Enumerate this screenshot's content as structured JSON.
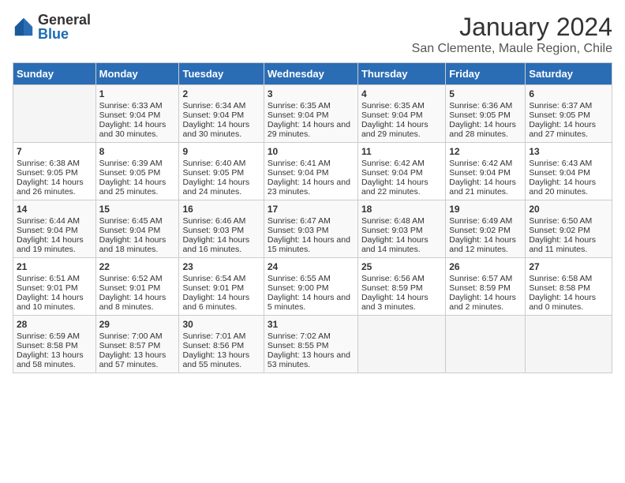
{
  "header": {
    "logo_general": "General",
    "logo_blue": "Blue",
    "title": "January 2024",
    "subtitle": "San Clemente, Maule Region, Chile"
  },
  "calendar": {
    "days_of_week": [
      "Sunday",
      "Monday",
      "Tuesday",
      "Wednesday",
      "Thursday",
      "Friday",
      "Saturday"
    ],
    "weeks": [
      [
        {
          "day": "",
          "content": ""
        },
        {
          "day": "1",
          "content": "Sunrise: 6:33 AM\nSunset: 9:04 PM\nDaylight: 14 hours and 30 minutes."
        },
        {
          "day": "2",
          "content": "Sunrise: 6:34 AM\nSunset: 9:04 PM\nDaylight: 14 hours and 30 minutes."
        },
        {
          "day": "3",
          "content": "Sunrise: 6:35 AM\nSunset: 9:04 PM\nDaylight: 14 hours and 29 minutes."
        },
        {
          "day": "4",
          "content": "Sunrise: 6:35 AM\nSunset: 9:04 PM\nDaylight: 14 hours and 29 minutes."
        },
        {
          "day": "5",
          "content": "Sunrise: 6:36 AM\nSunset: 9:05 PM\nDaylight: 14 hours and 28 minutes."
        },
        {
          "day": "6",
          "content": "Sunrise: 6:37 AM\nSunset: 9:05 PM\nDaylight: 14 hours and 27 minutes."
        }
      ],
      [
        {
          "day": "7",
          "content": "Sunrise: 6:38 AM\nSunset: 9:05 PM\nDaylight: 14 hours and 26 minutes."
        },
        {
          "day": "8",
          "content": "Sunrise: 6:39 AM\nSunset: 9:05 PM\nDaylight: 14 hours and 25 minutes."
        },
        {
          "day": "9",
          "content": "Sunrise: 6:40 AM\nSunset: 9:05 PM\nDaylight: 14 hours and 24 minutes."
        },
        {
          "day": "10",
          "content": "Sunrise: 6:41 AM\nSunset: 9:04 PM\nDaylight: 14 hours and 23 minutes."
        },
        {
          "day": "11",
          "content": "Sunrise: 6:42 AM\nSunset: 9:04 PM\nDaylight: 14 hours and 22 minutes."
        },
        {
          "day": "12",
          "content": "Sunrise: 6:42 AM\nSunset: 9:04 PM\nDaylight: 14 hours and 21 minutes."
        },
        {
          "day": "13",
          "content": "Sunrise: 6:43 AM\nSunset: 9:04 PM\nDaylight: 14 hours and 20 minutes."
        }
      ],
      [
        {
          "day": "14",
          "content": "Sunrise: 6:44 AM\nSunset: 9:04 PM\nDaylight: 14 hours and 19 minutes."
        },
        {
          "day": "15",
          "content": "Sunrise: 6:45 AM\nSunset: 9:04 PM\nDaylight: 14 hours and 18 minutes."
        },
        {
          "day": "16",
          "content": "Sunrise: 6:46 AM\nSunset: 9:03 PM\nDaylight: 14 hours and 16 minutes."
        },
        {
          "day": "17",
          "content": "Sunrise: 6:47 AM\nSunset: 9:03 PM\nDaylight: 14 hours and 15 minutes."
        },
        {
          "day": "18",
          "content": "Sunrise: 6:48 AM\nSunset: 9:03 PM\nDaylight: 14 hours and 14 minutes."
        },
        {
          "day": "19",
          "content": "Sunrise: 6:49 AM\nSunset: 9:02 PM\nDaylight: 14 hours and 12 minutes."
        },
        {
          "day": "20",
          "content": "Sunrise: 6:50 AM\nSunset: 9:02 PM\nDaylight: 14 hours and 11 minutes."
        }
      ],
      [
        {
          "day": "21",
          "content": "Sunrise: 6:51 AM\nSunset: 9:01 PM\nDaylight: 14 hours and 10 minutes."
        },
        {
          "day": "22",
          "content": "Sunrise: 6:52 AM\nSunset: 9:01 PM\nDaylight: 14 hours and 8 minutes."
        },
        {
          "day": "23",
          "content": "Sunrise: 6:54 AM\nSunset: 9:01 PM\nDaylight: 14 hours and 6 minutes."
        },
        {
          "day": "24",
          "content": "Sunrise: 6:55 AM\nSunset: 9:00 PM\nDaylight: 14 hours and 5 minutes."
        },
        {
          "day": "25",
          "content": "Sunrise: 6:56 AM\nSunset: 8:59 PM\nDaylight: 14 hours and 3 minutes."
        },
        {
          "day": "26",
          "content": "Sunrise: 6:57 AM\nSunset: 8:59 PM\nDaylight: 14 hours and 2 minutes."
        },
        {
          "day": "27",
          "content": "Sunrise: 6:58 AM\nSunset: 8:58 PM\nDaylight: 14 hours and 0 minutes."
        }
      ],
      [
        {
          "day": "28",
          "content": "Sunrise: 6:59 AM\nSunset: 8:58 PM\nDaylight: 13 hours and 58 minutes."
        },
        {
          "day": "29",
          "content": "Sunrise: 7:00 AM\nSunset: 8:57 PM\nDaylight: 13 hours and 57 minutes."
        },
        {
          "day": "30",
          "content": "Sunrise: 7:01 AM\nSunset: 8:56 PM\nDaylight: 13 hours and 55 minutes."
        },
        {
          "day": "31",
          "content": "Sunrise: 7:02 AM\nSunset: 8:55 PM\nDaylight: 13 hours and 53 minutes."
        },
        {
          "day": "",
          "content": ""
        },
        {
          "day": "",
          "content": ""
        },
        {
          "day": "",
          "content": ""
        }
      ]
    ]
  }
}
